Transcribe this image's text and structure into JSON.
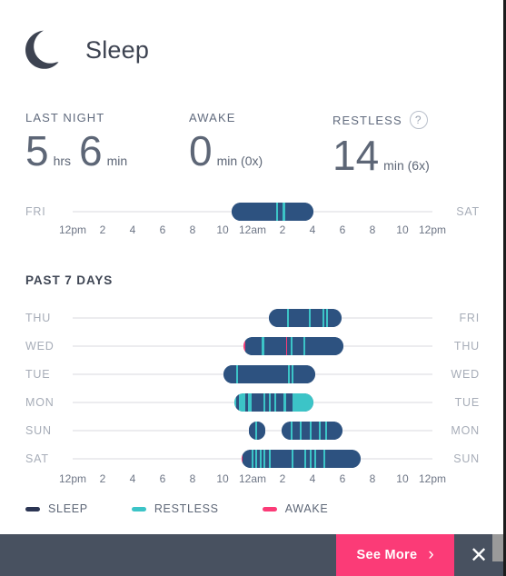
{
  "header": {
    "title": "Sleep",
    "icon": "moon-icon"
  },
  "stats": [
    {
      "label": "LAST NIGHT",
      "help": false,
      "parts": [
        {
          "value": "5",
          "unit": "hrs"
        },
        {
          "value": "6",
          "unit": "min"
        }
      ]
    },
    {
      "label": "AWAKE",
      "help": false,
      "parts": [
        {
          "value": "0",
          "unit": "min (0x)"
        }
      ]
    },
    {
      "label": "RESTLESS",
      "help": true,
      "help_glyph": "?",
      "parts": [
        {
          "value": "14",
          "unit": "min (6x)"
        }
      ]
    }
  ],
  "axis_ticks": [
    "12pm",
    "2",
    "4",
    "6",
    "8",
    "10",
    "12am",
    "2",
    "4",
    "6",
    "8",
    "10",
    "12pm"
  ],
  "last_night": {
    "left_label": "FRI",
    "right_label": "SAT"
  },
  "past_7_days": {
    "title": "PAST 7 DAYS"
  },
  "legend": [
    {
      "label": "SLEEP",
      "color": "#2b3553"
    },
    {
      "label": "RESTLESS",
      "color": "#3cc4c7"
    },
    {
      "label": "AWAKE",
      "color": "#fb3b77"
    }
  ],
  "footer": {
    "see_more_label": "See More",
    "chevron": "›",
    "close_glyph": "✕",
    "bar_color": "#485160",
    "accent_color": "#fb3b77"
  },
  "chart_data": {
    "type": "bar",
    "title": "Sleep timeline",
    "xlabel": "",
    "ylabel": "",
    "x_tick_labels": [
      "12pm",
      "2",
      "4",
      "6",
      "8",
      "10",
      "12am",
      "2",
      "4",
      "6",
      "8",
      "10",
      "12pm"
    ],
    "x_range_hours": [
      12,
      36
    ],
    "grid": false,
    "legend_position": "bottom",
    "series_colors": {
      "sleep": "#2d5280",
      "restless": "#3cc4c7",
      "awake": "#fb3b77"
    },
    "last_night": {
      "left_label": "FRI",
      "right_label": "SAT",
      "bars": [
        {
          "start_pct": 44.2,
          "end_pct": 67.0,
          "segments": [
            {
              "type": "sleep",
              "width_pct": 54
            },
            {
              "type": "restless",
              "width_pct": 3
            },
            {
              "type": "sleep",
              "width_pct": 5
            },
            {
              "type": "restless",
              "width_pct": 3
            },
            {
              "type": "sleep",
              "width_pct": 35
            }
          ]
        }
      ]
    },
    "rows": [
      {
        "left_label": "THU",
        "right_label": "FRI",
        "bars": [
          {
            "start_pct": 54.5,
            "end_pct": 74.7,
            "segments": [
              {
                "type": "sleep",
                "width_pct": 25
              },
              {
                "type": "restless",
                "width_pct": 2.5
              },
              {
                "type": "sleep",
                "width_pct": 28
              },
              {
                "type": "restless",
                "width_pct": 2.5
              },
              {
                "type": "sleep",
                "width_pct": 16
              },
              {
                "type": "restless",
                "width_pct": 2.5
              },
              {
                "type": "sleep",
                "width_pct": 2
              },
              {
                "type": "restless",
                "width_pct": 2.5
              },
              {
                "type": "sleep",
                "width_pct": 19
              }
            ]
          }
        ]
      },
      {
        "left_label": "WED",
        "right_label": "THU",
        "bars": [
          {
            "start_pct": 47.5,
            "end_pct": 75.2,
            "segments": [
              {
                "type": "awake",
                "width_pct": 1.5
              },
              {
                "type": "sleep",
                "width_pct": 17
              },
              {
                "type": "restless",
                "width_pct": 2
              },
              {
                "type": "sleep",
                "width_pct": 22
              },
              {
                "type": "awake",
                "width_pct": 1.5
              },
              {
                "type": "sleep",
                "width_pct": 3
              },
              {
                "type": "restless",
                "width_pct": 2
              },
              {
                "type": "sleep",
                "width_pct": 11
              },
              {
                "type": "restless",
                "width_pct": 2
              },
              {
                "type": "sleep",
                "width_pct": 38
              }
            ]
          }
        ]
      },
      {
        "left_label": "TUE",
        "right_label": "WED",
        "bars": [
          {
            "start_pct": 42.0,
            "end_pct": 67.5,
            "segments": [
              {
                "type": "sleep",
                "width_pct": 14
              },
              {
                "type": "restless",
                "width_pct": 2
              },
              {
                "type": "sleep",
                "width_pct": 54
              },
              {
                "type": "restless",
                "width_pct": 2
              },
              {
                "type": "sleep",
                "width_pct": 2
              },
              {
                "type": "restless",
                "width_pct": 2
              },
              {
                "type": "sleep",
                "width_pct": 24
              }
            ]
          }
        ]
      },
      {
        "left_label": "MON",
        "right_label": "TUE",
        "bars": [
          {
            "start_pct": 45.0,
            "end_pct": 67.0,
            "segments": [
              {
                "type": "restless",
                "width_pct": 2.5
              },
              {
                "type": "sleep",
                "width_pct": 2.5
              },
              {
                "type": "restless",
                "width_pct": 9
              },
              {
                "type": "sleep",
                "width_pct": 3
              },
              {
                "type": "restless",
                "width_pct": 5
              },
              {
                "type": "sleep",
                "width_pct": 14
              },
              {
                "type": "restless",
                "width_pct": 3
              },
              {
                "type": "sleep",
                "width_pct": 4
              },
              {
                "type": "restless",
                "width_pct": 3
              },
              {
                "type": "sleep",
                "width_pct": 4
              },
              {
                "type": "restless",
                "width_pct": 3
              },
              {
                "type": "sleep",
                "width_pct": 9
              },
              {
                "type": "restless",
                "width_pct": 3
              },
              {
                "type": "sleep",
                "width_pct": 8
              },
              {
                "type": "restless",
                "width_pct": 27
              }
            ]
          }
        ]
      },
      {
        "left_label": "SUN",
        "right_label": "MON",
        "bars": [
          {
            "start_pct": 49.0,
            "end_pct": 53.5,
            "segments": [
              {
                "type": "sleep",
                "width_pct": 38
              },
              {
                "type": "restless",
                "width_pct": 10
              },
              {
                "type": "sleep",
                "width_pct": 52
              }
            ]
          },
          {
            "start_pct": 58.0,
            "end_pct": 75.0,
            "segments": [
              {
                "type": "sleep",
                "width_pct": 16
              },
              {
                "type": "restless",
                "width_pct": 2.5
              },
              {
                "type": "sleep",
                "width_pct": 12
              },
              {
                "type": "restless",
                "width_pct": 2.5
              },
              {
                "type": "sleep",
                "width_pct": 14
              },
              {
                "type": "restless",
                "width_pct": 2.5
              },
              {
                "type": "sleep",
                "width_pct": 12
              },
              {
                "type": "restless",
                "width_pct": 2.5
              },
              {
                "type": "sleep",
                "width_pct": 8
              },
              {
                "type": "restless",
                "width_pct": 2.5
              },
              {
                "type": "sleep",
                "width_pct": 25
              }
            ]
          }
        ]
      },
      {
        "left_label": "SAT",
        "right_label": "SUN",
        "bars": [
          {
            "start_pct": 47.0,
            "end_pct": 80.0,
            "segments": [
              {
                "type": "awake",
                "width_pct": 1
              },
              {
                "type": "sleep",
                "width_pct": 7
              },
              {
                "type": "restless",
                "width_pct": 1.5
              },
              {
                "type": "sleep",
                "width_pct": 2
              },
              {
                "type": "restless",
                "width_pct": 1.5
              },
              {
                "type": "sleep",
                "width_pct": 2
              },
              {
                "type": "restless",
                "width_pct": 1.5
              },
              {
                "type": "sleep",
                "width_pct": 2
              },
              {
                "type": "restless",
                "width_pct": 1.5
              },
              {
                "type": "sleep",
                "width_pct": 3
              },
              {
                "type": "restless",
                "width_pct": 1.5
              },
              {
                "type": "sleep",
                "width_pct": 17
              },
              {
                "type": "restless",
                "width_pct": 1.5
              },
              {
                "type": "sleep",
                "width_pct": 9
              },
              {
                "type": "restless",
                "width_pct": 1.5
              },
              {
                "type": "sleep",
                "width_pct": 3
              },
              {
                "type": "restless",
                "width_pct": 1.5
              },
              {
                "type": "sleep",
                "width_pct": 3
              },
              {
                "type": "restless",
                "width_pct": 1.5
              },
              {
                "type": "sleep",
                "width_pct": 6
              },
              {
                "type": "restless",
                "width_pct": 1.5
              },
              {
                "type": "sleep",
                "width_pct": 29
              }
            ]
          }
        ]
      }
    ]
  }
}
